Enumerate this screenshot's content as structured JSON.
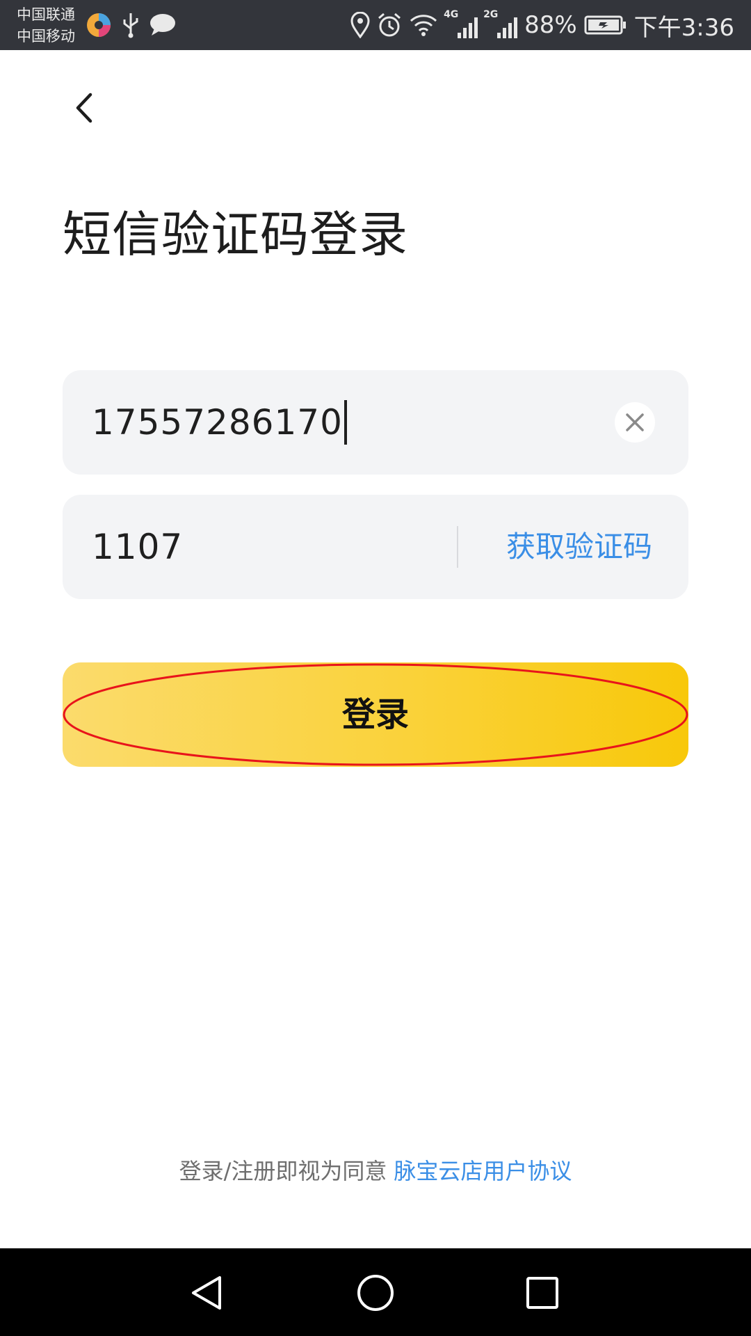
{
  "status_bar": {
    "carrier_1": "中国联通",
    "carrier_2": "中国移动",
    "network_1": "4G",
    "network_2": "2G",
    "battery": "88%",
    "time": "下午3:36",
    "icons": [
      "app-icon",
      "usb-icon",
      "message-icon",
      "location-icon",
      "alarm-icon",
      "wifi-icon",
      "signal-icon",
      "battery-icon"
    ]
  },
  "header": {
    "back_icon": "chevron-left-icon",
    "title": "短信验证码登录"
  },
  "form": {
    "phone_value": "17557286170",
    "code_value": "1107",
    "get_code_label": "获取验证码",
    "login_label": "登录"
  },
  "footer": {
    "agreement_text": "登录/注册即视为同意",
    "agreement_link": "脉宝云店用户协议"
  },
  "colors": {
    "status_bar": "#33353b",
    "field_bg": "#f3f4f6",
    "accent_link": "#3a8ee6",
    "button_start": "#fbdb6c",
    "button_end": "#f8c80a",
    "annotation": "#e8141b"
  },
  "nav_bar": {
    "icons": [
      "back-triangle-icon",
      "home-circle-icon",
      "recents-square-icon"
    ]
  }
}
